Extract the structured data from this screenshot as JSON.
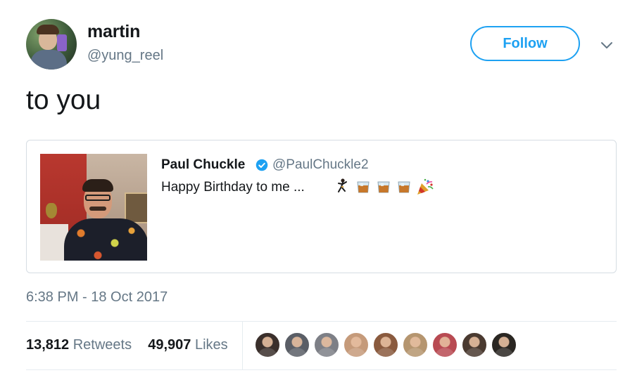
{
  "author": {
    "name": "martin",
    "handle": "@yung_reel",
    "follow_label": "Follow"
  },
  "tweet": {
    "text": "to you",
    "timestamp": "6:38 PM - 18 Oct 2017"
  },
  "quoted": {
    "name": "Paul Chuckle",
    "handle": "@PaulChuckle2",
    "text": "Happy Birthday to me ...",
    "emojis": [
      "dancer",
      "tumbler-glass",
      "tumbler-glass",
      "tumbler-glass",
      "party-popper"
    ]
  },
  "stats": {
    "retweets_count": "13,812",
    "retweets_label": "Retweets",
    "likes_count": "49,907",
    "likes_label": "Likes"
  },
  "likers": [
    {
      "color": "#3a2f2b"
    },
    {
      "color": "#5a5e66"
    },
    {
      "color": "#7d7f86"
    },
    {
      "color": "#c59a7a"
    },
    {
      "color": "#8a5a3e"
    },
    {
      "color": "#b5956f"
    },
    {
      "color": "#b84a52"
    },
    {
      "color": "#4a3a30"
    },
    {
      "color": "#2a2622"
    }
  ],
  "colors": {
    "accent": "#1da1f2",
    "text": "#14171a",
    "muted": "#657786",
    "border": "#e6ecf0"
  }
}
